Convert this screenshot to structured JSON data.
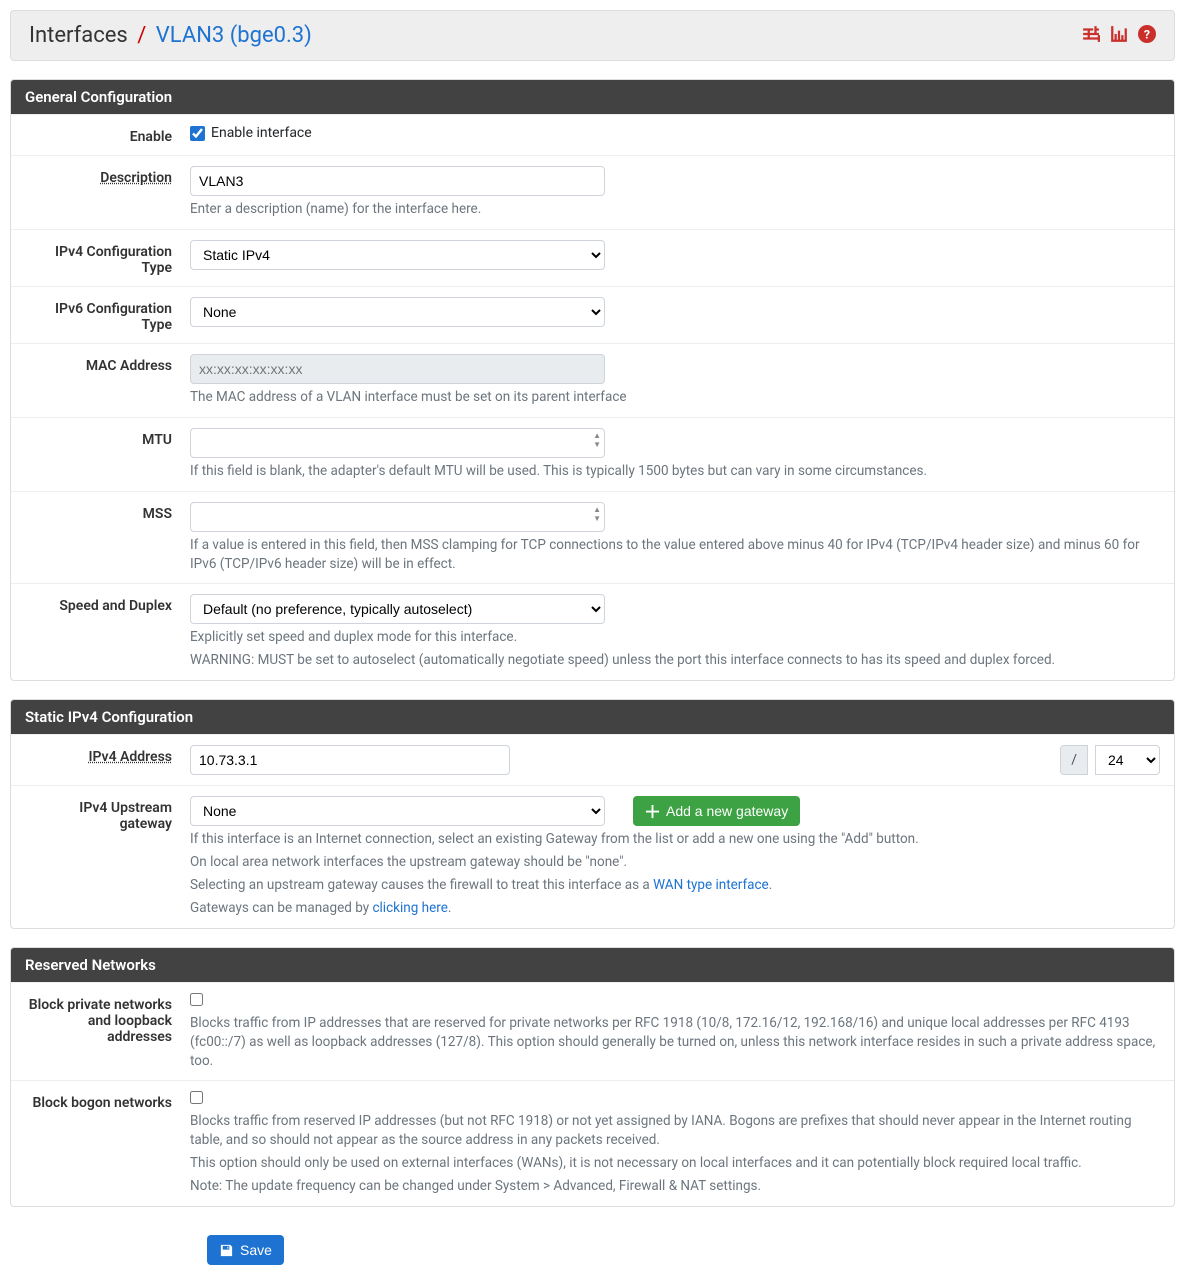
{
  "breadcrumb": {
    "root": "Interfaces",
    "sep": "/",
    "leaf": "VLAN3 (bge0.3)"
  },
  "sections": {
    "general": "General Configuration",
    "static_ipv4": "Static IPv4 Configuration",
    "reserved": "Reserved Networks"
  },
  "fields": {
    "enable": {
      "label": "Enable",
      "text": "Enable interface",
      "checked": true
    },
    "description": {
      "label": "Description",
      "value": "VLAN3",
      "help": "Enter a description (name) for the interface here."
    },
    "ipv4type": {
      "label": "IPv4 Configuration Type",
      "value": "Static IPv4"
    },
    "ipv6type": {
      "label": "IPv6 Configuration Type",
      "value": "None"
    },
    "mac": {
      "label": "MAC Address",
      "placeholder": "xx:xx:xx:xx:xx:xx",
      "help": "The MAC address of a VLAN interface must be set on its parent interface"
    },
    "mtu": {
      "label": "MTU",
      "help": "If this field is blank, the adapter's default MTU will be used. This is typically 1500 bytes but can vary in some circumstances."
    },
    "mss": {
      "label": "MSS",
      "help": "If a value is entered in this field, then MSS clamping for TCP connections to the value entered above minus 40 for IPv4 (TCP/IPv4 header size) and minus 60 for IPv6 (TCP/IPv6 header size) will be in effect."
    },
    "speed": {
      "label": "Speed and Duplex",
      "value": "Default (no preference, typically autoselect)",
      "help1": "Explicitly set speed and duplex mode for this interface.",
      "help2": "WARNING: MUST be set to autoselect (automatically negotiate speed) unless the port this interface connects to has its speed and duplex forced."
    },
    "ipv4addr": {
      "label": "IPv4 Address",
      "value": "10.73.3.1",
      "slash": "/",
      "cidr": "24"
    },
    "gateway": {
      "label": "IPv4 Upstream gateway",
      "value": "None",
      "button": "Add a new gateway",
      "help1": "If this interface is an Internet connection, select an existing Gateway from the list or add a new one using the \"Add\" button.",
      "help2": "On local area network interfaces the upstream gateway should be \"none\".",
      "help3a": "Selecting an upstream gateway causes the firewall to treat this interface as a ",
      "help3link": "WAN type interface",
      "help3b": ".",
      "help4a": "Gateways can be managed by ",
      "help4link": "clicking here",
      "help4b": "."
    },
    "blockpriv": {
      "label": "Block private networks and loopback addresses",
      "help": "Blocks traffic from IP addresses that are reserved for private networks per RFC 1918 (10/8, 172.16/12, 192.168/16) and unique local addresses per RFC 4193 (fc00::/7) as well as loopback addresses (127/8). This option should generally be turned on, unless this network interface resides in such a private address space, too."
    },
    "blockbogon": {
      "label": "Block bogon networks",
      "help1": "Blocks traffic from reserved IP addresses (but not RFC 1918) or not yet assigned by IANA. Bogons are prefixes that should never appear in the Internet routing table, and so should not appear as the source address in any packets received.",
      "help2": "This option should only be used on external interfaces (WANs), it is not necessary on local interfaces and it can potentially block required local traffic.",
      "help3": "Note: The update frequency can be changed under System > Advanced, Firewall & NAT settings."
    }
  },
  "buttons": {
    "save": "Save"
  }
}
